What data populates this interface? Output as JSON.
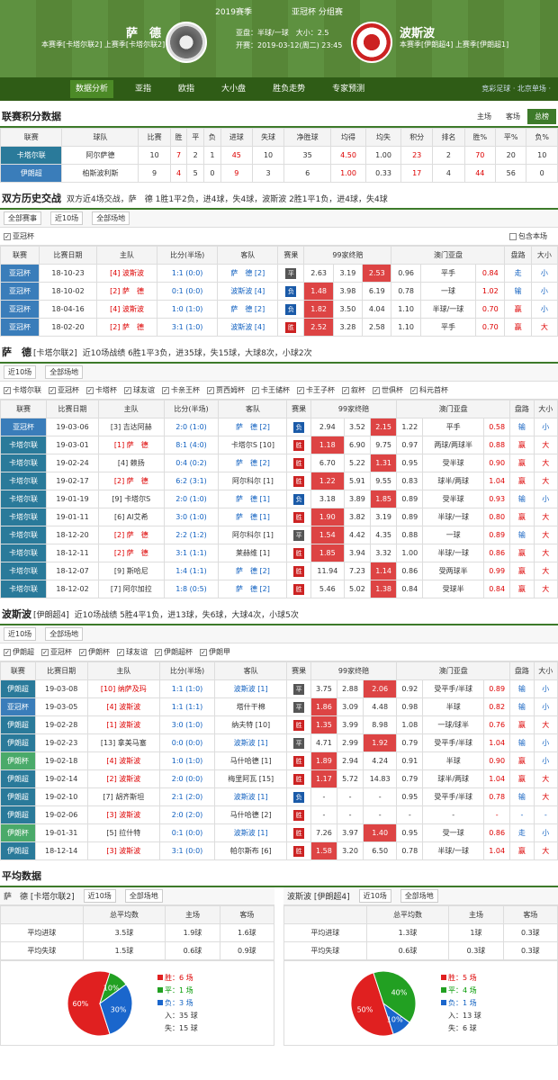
{
  "header": {
    "season": "2019赛季",
    "league": "亚冠杯 分组赛",
    "home": "萨　德",
    "home_info": "本赛季[卡塔尔联2] 上赛季[卡塔尔联2]",
    "away": "波斯波",
    "away_info": "本赛季[伊朗超4] 上赛季[伊朗超1]",
    "odds": "亚盘：半球/一球　大小：2.5",
    "kickoff": "开赛：2019-03-12(周二) 23:45"
  },
  "nav": {
    "items": [
      "数据分析",
      "亚指",
      "欧指",
      "大小盘",
      "胜负走势",
      "专家预测"
    ],
    "right": "竞彩足球 · 北京单场 ·"
  },
  "standings": {
    "title": "联赛积分数据",
    "tabs": [
      "主场",
      "客场",
      "总榜"
    ],
    "headers": [
      "联赛",
      "球队",
      "比赛",
      "胜",
      "平",
      "负",
      "进球",
      "失球",
      "净胜球",
      "均得",
      "均失",
      "积分",
      "排名",
      "胜%",
      "平%",
      "负%"
    ],
    "rows": [
      [
        "卡塔尔联",
        "阿尔萨德",
        "10",
        "7",
        "2",
        "1",
        "45",
        "10",
        "35",
        "4.50",
        "1.00",
        "23",
        "2",
        "70",
        "20",
        "10"
      ],
      [
        "伊朗超",
        "柏斯波利斯",
        "9",
        "4",
        "5",
        "0",
        "9",
        "3",
        "6",
        "1.00",
        "0.33",
        "17",
        "4",
        "44",
        "56",
        "0"
      ]
    ]
  },
  "h2h": {
    "title": "双方历史交战",
    "summary": "双方近4场交战，萨　德 1胜1平2负，进4球，失4球，波斯波 2胜1平1负，进4球，失4球",
    "filters": [
      "全部赛事",
      "近10场",
      "全部场地"
    ],
    "ck": "亚冠杯",
    "ck2": "包含本场",
    "headers": [
      "联赛",
      "比赛日期",
      "主队",
      "比分(半场)",
      "客队",
      "赛果",
      "99家终赔",
      "澳门亚盘",
      "盘路",
      "大小"
    ],
    "rows": [
      [
        "亚冠杯",
        "18-10-23",
        "[4] 波斯波",
        "1:1 (0:0)",
        "萨　德 [2]",
        "平",
        "2.63",
        "3.19",
        "2.53",
        "0.96",
        "平手",
        "0.84",
        "走",
        "小"
      ],
      [
        "亚冠杯",
        "18-10-02",
        "[2] 萨　德",
        "0:1 (0:0)",
        "波斯波 [4]",
        "负",
        "1.48",
        "3.98",
        "6.19",
        "0.78",
        "一球",
        "1.02",
        "输",
        "小"
      ],
      [
        "亚冠杯",
        "18-04-16",
        "[4] 波斯波",
        "1:0 (1:0)",
        "萨　德 [2]",
        "负",
        "1.82",
        "3.50",
        "4.04",
        "1.10",
        "半球/一球",
        "0.70",
        "赢",
        "小"
      ],
      [
        "亚冠杯",
        "18-02-20",
        "[2] 萨　德",
        "3:1 (1:0)",
        "波斯波 [4]",
        "胜",
        "2.52",
        "3.28",
        "2.58",
        "1.10",
        "平手",
        "0.70",
        "赢",
        "大"
      ]
    ]
  },
  "sadd": {
    "title": "萨　德",
    "rank": "[卡塔尔联2]",
    "summary": "近10场战绩 6胜1平3负，进35球，失15球，大球8次，小球2次",
    "filters": [
      "近10场",
      "全部场地"
    ],
    "cks": [
      "卡塔尔联",
      "亚冠杯",
      "卡塔杯",
      "球友谊",
      "卡亲王杯",
      "贾西姆杯",
      "卡王储杯",
      "卡王子杯",
      "叙杯",
      "世俱杯",
      "科元首杯"
    ],
    "rows": [
      [
        "亚冠杯",
        "19-03-06",
        "[3] 吉达阿赫",
        "2:0 (1:0)",
        "萨　德 [2]",
        "负",
        "2.94",
        "3.52",
        "2.15",
        "1.22",
        "平手",
        "0.58",
        "输",
        "小"
      ],
      [
        "卡塔尔联",
        "19-03-01",
        "[1] 萨　德",
        "8:1 (4:0)",
        "卡塔尔S [10]",
        "胜",
        "1.18",
        "6.90",
        "9.75",
        "0.97",
        "两球/两球半",
        "0.88",
        "赢",
        "大"
      ],
      [
        "卡塔尔联",
        "19-02-24",
        "[4] 赖扬",
        "0:4 (0:2)",
        "萨　德 [2]",
        "胜",
        "6.70",
        "5.22",
        "1.31",
        "0.95",
        "受半球",
        "0.90",
        "赢",
        "大"
      ],
      [
        "卡塔尔联",
        "19-02-17",
        "[2] 萨　德",
        "6:2 (3:1)",
        "阿尔科尔 [1]",
        "胜",
        "1.22",
        "5.91",
        "9.55",
        "0.83",
        "球半/两球",
        "1.04",
        "赢",
        "大"
      ],
      [
        "卡塔尔联",
        "19-01-19",
        "[9] 卡塔尔S",
        "2:0 (1:0)",
        "萨　德 [1]",
        "负",
        "3.18",
        "3.89",
        "1.85",
        "0.89",
        "受半球",
        "0.93",
        "输",
        "小"
      ],
      [
        "卡塔尔联",
        "19-01-11",
        "[6] Al艾希",
        "3:0 (1:0)",
        "萨　德 [1]",
        "胜",
        "1.90",
        "3.82",
        "3.19",
        "0.89",
        "半球/一球",
        "0.80",
        "赢",
        "大"
      ],
      [
        "卡塔尔联",
        "18-12-20",
        "[2] 萨　德",
        "2:2 (1:2)",
        "阿尔科尔 [1]",
        "平",
        "1.54",
        "4.42",
        "4.35",
        "0.88",
        "一球",
        "0.89",
        "输",
        "大"
      ],
      [
        "卡塔尔联",
        "18-12-11",
        "[2] 萨　德",
        "3:1 (1:1)",
        "莱赫维 [1]",
        "胜",
        "1.85",
        "3.94",
        "3.32",
        "1.00",
        "半球/一球",
        "0.86",
        "赢",
        "大"
      ],
      [
        "卡塔尔联",
        "18-12-07",
        "[9] 斯哈尼",
        "1:4 (1:1)",
        "萨　德 [2]",
        "胜",
        "11.94",
        "7.23",
        "1.14",
        "0.86",
        "受两球半",
        "0.99",
        "赢",
        "大"
      ],
      [
        "卡塔尔联",
        "18-12-02",
        "[7] 阿尔加拉",
        "1:8 (0:5)",
        "萨　德 [2]",
        "胜",
        "5.46",
        "5.02",
        "1.38",
        "0.84",
        "受球半",
        "0.84",
        "赢",
        "大"
      ]
    ]
  },
  "pers": {
    "title": "波斯波",
    "rank": "[伊朗超4]",
    "summary": "近10场战绩 5胜4平1负，进13球，失6球，大球4次，小球5次",
    "filters": [
      "近10场",
      "全部场地"
    ],
    "cks": [
      "伊朗超",
      "亚冠杯",
      "伊朗杯",
      "球友谊",
      "伊朗超杯",
      "伊朗甲"
    ],
    "rows": [
      [
        "伊朗超",
        "19-03-08",
        "[10] 纳萨及玛",
        "1:1 (1:0)",
        "波斯波 [1]",
        "平",
        "3.75",
        "2.88",
        "2.06",
        "0.92",
        "受平手/半球",
        "0.89",
        "输",
        "小"
      ],
      [
        "亚冠杯",
        "19-03-05",
        "[4] 波斯波",
        "1:1 (1:1)",
        "塔什干棉",
        "平",
        "1.86",
        "3.09",
        "4.48",
        "0.98",
        "半球",
        "0.82",
        "输",
        "小"
      ],
      [
        "伊朗超",
        "19-02-28",
        "[1] 波斯波",
        "3:0 (1:0)",
        "纳夫特 [10]",
        "胜",
        "1.35",
        "3.99",
        "8.98",
        "1.08",
        "一球/球半",
        "0.76",
        "赢",
        "大"
      ],
      [
        "伊朗超",
        "19-02-23",
        "[13] 拿美马塞",
        "0:0 (0:0)",
        "波斯波 [1]",
        "平",
        "4.71",
        "2.99",
        "1.92",
        "0.79",
        "受平手/半球",
        "1.04",
        "输",
        "小"
      ],
      [
        "伊朗杯",
        "19-02-18",
        "[4] 波斯波",
        "1:0 (1:0)",
        "马什哈德 [1]",
        "胜",
        "1.89",
        "2.94",
        "4.24",
        "0.91",
        "半球",
        "0.90",
        "赢",
        "小"
      ],
      [
        "伊朗超",
        "19-02-14",
        "[2] 波斯波",
        "2:0 (0:0)",
        "梅里阿瓦 [15]",
        "胜",
        "1.17",
        "5.72",
        "14.83",
        "0.79",
        "球半/两球",
        "1.04",
        "赢",
        "大"
      ],
      [
        "伊朗超",
        "19-02-10",
        "[7] 胡齐斯坦",
        "2:1 (2:0)",
        "波斯波 [1]",
        "负",
        "-",
        "-",
        "-",
        "0.95",
        "受平手/半球",
        "0.78",
        "输",
        "大"
      ],
      [
        "伊朗超",
        "19-02-06",
        "[3] 波斯波",
        "2:0 (2:0)",
        "马什哈德 [2]",
        "胜",
        "-",
        "-",
        "-",
        "-",
        "-",
        "-",
        "-",
        "-"
      ],
      [
        "伊朗杯",
        "19-01-31",
        "[5] 拉什特",
        "0:1 (0:0)",
        "波斯波 [1]",
        "胜",
        "7.26",
        "3.97",
        "1.40",
        "0.95",
        "受一球",
        "0.86",
        "走",
        "小"
      ],
      [
        "伊朗超",
        "18-12-14",
        "[3] 波斯波",
        "3:1 (0:0)",
        "帕尔斯布 [6]",
        "胜",
        "1.58",
        "3.20",
        "6.50",
        "0.78",
        "半球/一球",
        "1.04",
        "赢",
        "大"
      ]
    ]
  },
  "avg": {
    "title": "平均数据",
    "home": {
      "name": "萨　德",
      "rank": "[卡塔尔联2]",
      "f1": "近10场",
      "f2": "全部场地",
      "headers": [
        "",
        "总平均数",
        "主场",
        "客场"
      ],
      "rows": [
        [
          "平均进球",
          "3.5球",
          "1.9球",
          "1.6球"
        ],
        [
          "平均失球",
          "1.5球",
          "0.6球",
          "0.9球"
        ]
      ],
      "pie": {
        "w": 60,
        "d": 10,
        "l": 30
      },
      "legend": [
        "胜：6 场",
        "平：1 场",
        "负：3 场",
        "入：35 球",
        "失：15 球"
      ]
    },
    "away": {
      "name": "波斯波",
      "rank": "[伊朗超4]",
      "f1": "近10场",
      "f2": "全部场地",
      "headers": [
        "",
        "总平均数",
        "主场",
        "客场"
      ],
      "rows": [
        [
          "平均进球",
          "1.3球",
          "1球",
          "0.3球"
        ],
        [
          "平均失球",
          "0.6球",
          "0.3球",
          "0.3球"
        ]
      ],
      "pie": {
        "w": 50,
        "d": 40,
        "l": 10
      },
      "legend": [
        "胜：5 场",
        "平：4 场",
        "负：1 场",
        "入：13 球",
        "失：6 球"
      ]
    }
  },
  "colors": {
    "win": "#e02020",
    "draw": "#22a022",
    "loss": "#1a66cc"
  }
}
